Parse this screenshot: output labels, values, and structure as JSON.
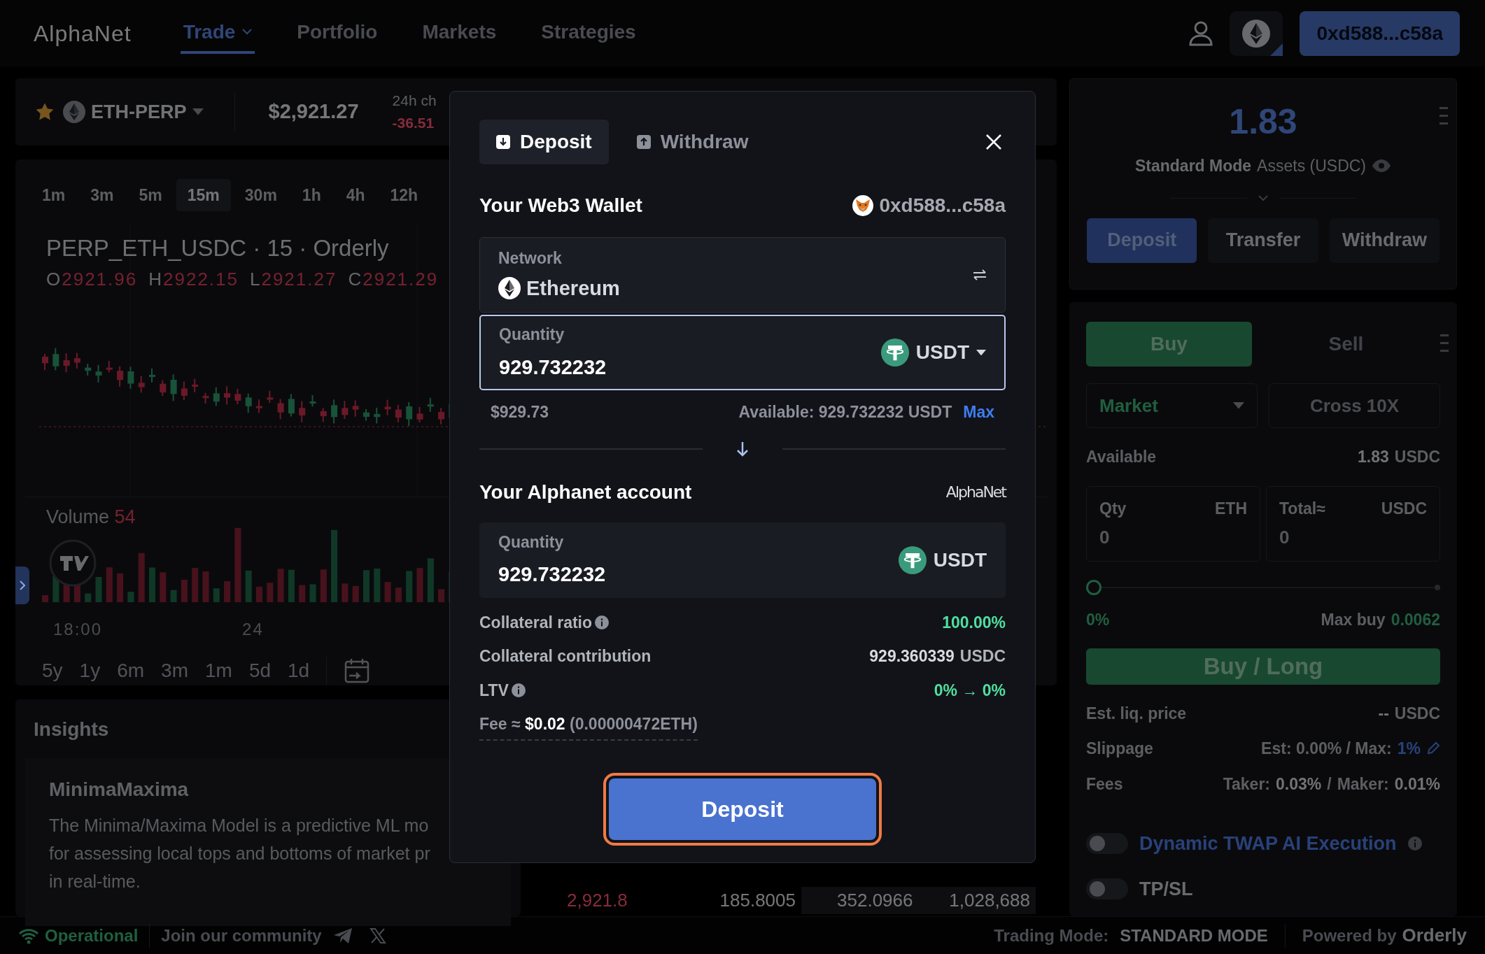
{
  "nav": {
    "logo": "AlphaNet",
    "items": [
      {
        "label": "Trade",
        "selected": true,
        "dropdown": true
      },
      {
        "label": "Portfolio",
        "selected": false,
        "dropdown": false
      },
      {
        "label": "Markets",
        "selected": false,
        "dropdown": false
      },
      {
        "label": "Strategies",
        "selected": false,
        "dropdown": false
      }
    ],
    "wallet_address": "0xd588...c58a"
  },
  "market": {
    "symbol": "ETH-PERP",
    "favorite": true,
    "price": "$2,921.27",
    "change_label": "24h ch",
    "change_value": "-36.51"
  },
  "chart": {
    "timeframes": [
      {
        "label": "1m",
        "selected": false
      },
      {
        "label": "3m",
        "selected": false
      },
      {
        "label": "5m",
        "selected": false
      },
      {
        "label": "15m",
        "selected": true
      },
      {
        "label": "30m",
        "selected": false
      },
      {
        "label": "1h",
        "selected": false
      },
      {
        "label": "4h",
        "selected": false
      },
      {
        "label": "12h",
        "selected": false
      }
    ],
    "title": "PERP_ETH_USDC · 15 · Orderly",
    "ohlc": [
      {
        "key": "O",
        "value": "2921.96"
      },
      {
        "key": "H",
        "value": "2922.15"
      },
      {
        "key": "L",
        "value": "2921.27"
      },
      {
        "key": "C",
        "value": "2921.29"
      }
    ],
    "volume_label": "Volume",
    "volume_value": "54",
    "time_labels": [
      "18:00",
      "24"
    ],
    "ranges": [
      "5y",
      "1y",
      "6m",
      "3m",
      "1m",
      "5d",
      "1d"
    ]
  },
  "insights": {
    "title": "Insights",
    "card_title": "MinimaMaxima",
    "lines": [
      "The Minima/Maxima Model is a predictive ML mo",
      "for assessing local tops and bottoms of market pr",
      "in real-time."
    ]
  },
  "orderbook_rows": [
    [
      "2,921.8",
      "185.8005",
      "352.0966",
      "1,028,688"
    ]
  ],
  "account": {
    "balance": "1.83",
    "mode": "Standard Mode",
    "assets_label": "Assets (USDC)",
    "buttons": [
      {
        "label": "Deposit",
        "kind": "primary"
      },
      {
        "label": "Transfer",
        "kind": "secondary"
      },
      {
        "label": "Withdraw",
        "kind": "secondary"
      }
    ]
  },
  "order": {
    "sides": [
      {
        "label": "Buy",
        "selected": true
      },
      {
        "label": "Sell",
        "selected": false
      }
    ],
    "order_type": "Market",
    "margin": "Cross 10X",
    "available_label": "Available",
    "available_value": "1.83",
    "available_unit": "USDC",
    "fields": [
      {
        "label": "Qty",
        "unit": "ETH",
        "placeholder": "0"
      },
      {
        "label": "Total≈",
        "unit": "USDC",
        "placeholder": "0"
      }
    ],
    "slider": {
      "level": 0
    },
    "percent": "0%",
    "max_buy_label": "Max buy",
    "max_buy_value": "0.0062",
    "submit": "Buy / Long",
    "info": [
      {
        "label": "Est. liq. price",
        "editable": false,
        "parts": [
          {
            "text": "--",
            "kind": "strong"
          },
          {
            "text": "USDC",
            "kind": "muted"
          }
        ]
      },
      {
        "label": "Slippage",
        "editable": true,
        "parts": [
          {
            "text": "Est: 0.00% / Max:",
            "kind": "muted"
          },
          {
            "text": "1%",
            "kind": "link"
          }
        ]
      },
      {
        "label": "Fees",
        "editable": false,
        "parts": [
          {
            "text": "Taker:",
            "kind": "muted"
          },
          {
            "text": "0.03%",
            "kind": "strong"
          },
          {
            "text": "/",
            "kind": "muted"
          },
          {
            "text": "Maker:",
            "kind": "muted"
          },
          {
            "text": "0.01%",
            "kind": "strong"
          }
        ]
      }
    ],
    "toggles": [
      {
        "label": "Dynamic TWAP AI Execution",
        "on": false,
        "info": true,
        "kind": "link"
      },
      {
        "label": "TP/SL",
        "on": false,
        "info": false,
        "kind": "plain"
      }
    ]
  },
  "modal": {
    "tabs": [
      {
        "label": "Deposit",
        "selected": true,
        "kind": "deposit"
      },
      {
        "label": "Withdraw",
        "selected": false,
        "kind": "withdraw"
      }
    ],
    "source": {
      "title": "Your Web3 Wallet",
      "address": "0xd588...c58a",
      "network_label": "Network",
      "network": "Ethereum",
      "quantity_label": "Quantity",
      "quantity": "929.732232",
      "token": "USDT",
      "usd_value": "$929.73",
      "available": "Available: 929.732232 USDT",
      "max": "Max"
    },
    "target": {
      "title": "Your Alphanet account",
      "logo": "AlphaNet",
      "quantity_label": "Quantity",
      "quantity": "929.732232",
      "token": "USDT"
    },
    "details": [
      {
        "label": "Collateral ratio",
        "info": true,
        "parts": [
          {
            "text": "100.00%",
            "kind": "positive"
          }
        ]
      },
      {
        "label": "Collateral contribution",
        "info": false,
        "parts": [
          {
            "text": "929.360339",
            "kind": "strong"
          },
          {
            "text": "USDC",
            "kind": "muted"
          }
        ]
      },
      {
        "label": "LTV",
        "info": true,
        "parts": [
          {
            "text": "0% → 0%",
            "kind": "positive"
          }
        ]
      }
    ],
    "fee": "Fee ≈ **$0.02** (0.00000472ETH)",
    "submit": "Deposit"
  },
  "footer": {
    "status": "Operational",
    "community": "Join our community",
    "trading_mode_label": "Trading Mode:",
    "trading_mode": "STANDARD MODE",
    "powered_by": "Powered by",
    "brand": "Orderly"
  }
}
